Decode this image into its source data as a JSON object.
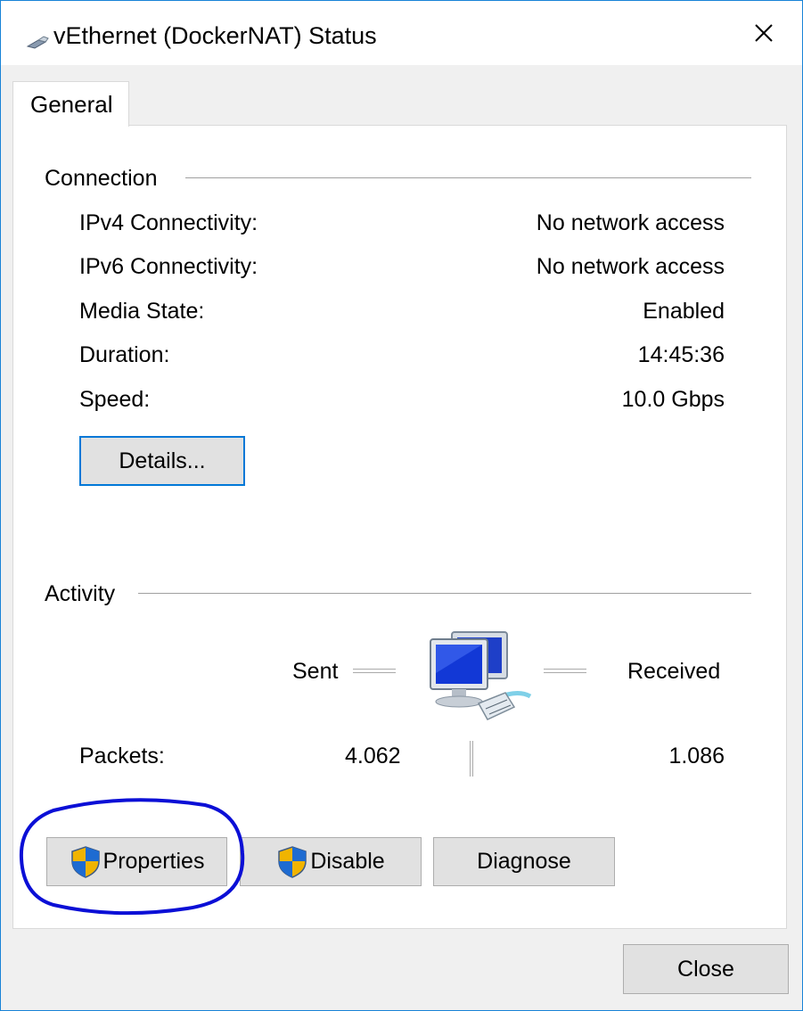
{
  "window": {
    "title": "vEthernet (DockerNAT) Status",
    "icons": {
      "title": "network-adapter-icon",
      "close": "close-icon"
    }
  },
  "tabs": [
    {
      "label": "General",
      "selected": true
    }
  ],
  "connection": {
    "heading": "Connection",
    "rows": [
      {
        "label": "IPv4 Connectivity:",
        "value": "No network access"
      },
      {
        "label": "IPv6 Connectivity:",
        "value": "No network access"
      },
      {
        "label": "Media State:",
        "value": "Enabled"
      },
      {
        "label": "Duration:",
        "value": "14:45:36"
      },
      {
        "label": "Speed:",
        "value": "10.0 Gbps"
      }
    ],
    "details_button": "Details..."
  },
  "activity": {
    "heading": "Activity",
    "sent_label": "Sent",
    "received_label": "Received",
    "packets_label": "Packets:",
    "packets_sent": "4.062",
    "packets_received": "1.086",
    "icon": "network-computers-icon"
  },
  "buttons": {
    "properties": "Properties",
    "disable": "Disable",
    "diagnose": "Diagnose",
    "close": "Close"
  },
  "annotation": {
    "color": "#0b0fd6",
    "shape": "hand-drawn-ellipse"
  },
  "colors": {
    "accent": "#0078d7",
    "button_bg": "#e1e1e1",
    "dialog_bg": "#f0f0f0"
  }
}
